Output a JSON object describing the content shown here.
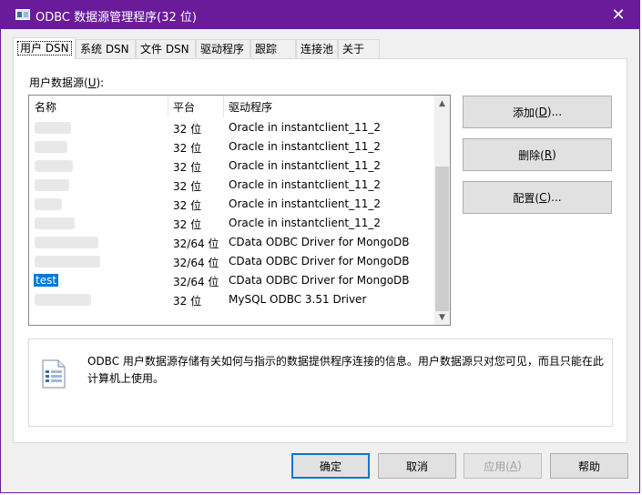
{
  "window": {
    "title": "ODBC 数据源管理程序(32 位)",
    "close_glyph": "✕",
    "accent_color": "#6a1b9a"
  },
  "tabs": [
    {
      "label": "用户 DSN",
      "active": true
    },
    {
      "label": "系统 DSN"
    },
    {
      "label": "文件 DSN"
    },
    {
      "label": "驱动程序"
    },
    {
      "label": "跟踪"
    },
    {
      "label": "连接池"
    },
    {
      "label": "关于"
    }
  ],
  "list": {
    "group_label_prefix": "用户数据源(",
    "group_label_hotkey": "U",
    "group_label_suffix": "):",
    "columns": {
      "name": "名称",
      "platform": "平台",
      "driver": "驱动程序"
    },
    "rows": [
      {
        "name": "",
        "platform": "32 位",
        "driver": "Oracle in instantclient_11_2"
      },
      {
        "name": "",
        "platform": "32 位",
        "driver": "Oracle in instantclient_11_2"
      },
      {
        "name": "",
        "platform": "32 位",
        "driver": "Oracle in instantclient_11_2"
      },
      {
        "name": "",
        "platform": "32 位",
        "driver": "Oracle in instantclient_11_2"
      },
      {
        "name": "",
        "platform": "32 位",
        "driver": "Oracle in instantclient_11_2"
      },
      {
        "name": "",
        "platform": "32 位",
        "driver": "Oracle in instantclient_11_2"
      },
      {
        "name": "",
        "platform": "32/64 位",
        "driver": "CData ODBC Driver for MongoDB"
      },
      {
        "name": "",
        "platform": "32/64 位",
        "driver": "CData ODBC Driver for MongoDB"
      },
      {
        "name": "test",
        "platform": "32/64 位",
        "driver": "CData ODBC Driver for MongoDB",
        "selected": true
      },
      {
        "name": "",
        "platform": "32 位",
        "driver": "MySQL ODBC 3.51 Driver"
      }
    ],
    "scroll_up_glyph": "▲",
    "scroll_down_glyph": "▼"
  },
  "side_buttons": {
    "add": {
      "prefix": "添加(",
      "hotkey": "D",
      "suffix": ")..."
    },
    "remove": {
      "prefix": "删除(",
      "hotkey": "R",
      "suffix": ")"
    },
    "configure": {
      "prefix": "配置(",
      "hotkey": "C",
      "suffix": ")..."
    }
  },
  "info": {
    "text": "ODBC 用户数据源存储有关如何与指示的数据提供程序连接的信息。用户数据源只对您可见，而且只能在此计算机上使用。"
  },
  "footer": {
    "ok": "确定",
    "cancel": "取消",
    "apply": {
      "prefix": "应用(",
      "hotkey": "A",
      "suffix": ")"
    },
    "help": "帮助"
  },
  "selection_color": "#0078d7"
}
